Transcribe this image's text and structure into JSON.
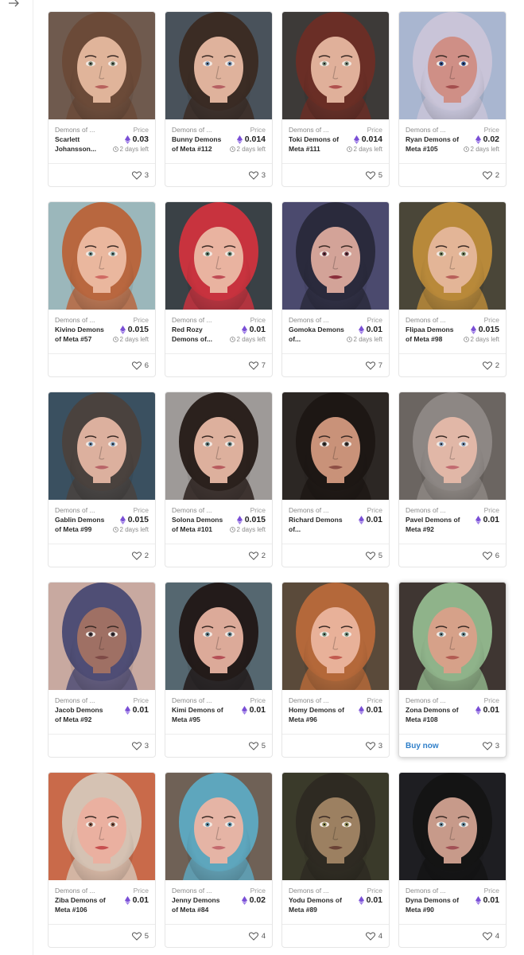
{
  "nav": {
    "back_icon": "arrow-right-icon"
  },
  "colors": {
    "accent": "#2f7fc9",
    "eth": "#7a4fd6",
    "border": "#e6e6e6"
  },
  "cards": [
    {
      "collection": "Demons of ...",
      "name": "Scarlett Johansson...",
      "price_label": "Price",
      "price": "0.03",
      "time": "2 days left",
      "likes": "3",
      "buy": "",
      "hair": "#6b4a38",
      "skin": "#e0b49a",
      "bg": "#6f5a4e",
      "eyes": "#6e7d6a",
      "lips": "#b8625d"
    },
    {
      "collection": "Demons of ...",
      "name": "Bunny Demons of Meta #112",
      "price_label": "Price",
      "price": "0.014",
      "time": "2 days left",
      "likes": "3",
      "buy": "",
      "hair": "#3b2c24",
      "skin": "#dfb29c",
      "bg": "#49525b",
      "eyes": "#6b87a8",
      "lips": "#b66063"
    },
    {
      "collection": "Demons of ...",
      "name": "Toki Demons of Meta #111",
      "price_label": "Price",
      "price": "0.014",
      "time": "2 days left",
      "likes": "5",
      "buy": "",
      "hair": "#6a2e26",
      "skin": "#e0b09a",
      "bg": "#3d3a38",
      "eyes": "#7a8b7a",
      "lips": "#b0514f"
    },
    {
      "collection": "Demons of ...",
      "name": "Ryan Demons of Meta #105",
      "price_label": "Price",
      "price": "0.02",
      "time": "2 days left",
      "likes": "2",
      "buy": "",
      "hair": "#c9c4d8",
      "skin": "#cf8f86",
      "bg": "#a9b6d0",
      "eyes": "#2d4d8a",
      "lips": "#a44e4e"
    },
    {
      "collection": "Demons of ...",
      "name": "Kivino Demons of Meta #57",
      "price_label": "Price",
      "price": "0.015",
      "time": "2 days left",
      "likes": "6",
      "buy": "",
      "hair": "#b8673f",
      "skin": "#eab79e",
      "bg": "#9bb7bb",
      "eyes": "#6f8f8c",
      "lips": "#d06a63"
    },
    {
      "collection": "Demons of ...",
      "name": "Red Rozy Demons of...",
      "price_label": "Price",
      "price": "0.01",
      "time": "2 days left",
      "likes": "7",
      "buy": "",
      "hair": "#c8333e",
      "skin": "#e9b3a0",
      "bg": "#3a4146",
      "eyes": "#5f7f6e",
      "lips": "#c04c55"
    },
    {
      "collection": "Demons of ...",
      "name": "Gomoka Demons of...",
      "price_label": "Price",
      "price": "0.01",
      "time": "2 days left",
      "likes": "7",
      "buy": "",
      "hair": "#2a2a3c",
      "skin": "#d3a398",
      "bg": "#4b4a6e",
      "eyes": "#6b3340",
      "lips": "#8a2e3b"
    },
    {
      "collection": "Demons of ...",
      "name": "Flipaa Demons of Meta #98",
      "price_label": "Price",
      "price": "0.015",
      "time": "2 days left",
      "likes": "2",
      "buy": "",
      "hair": "#b8893a",
      "skin": "#e3b597",
      "bg": "#4a4638",
      "eyes": "#7c8a63",
      "lips": "#b8605a"
    },
    {
      "collection": "Demons of ...",
      "name": "Gablin Demons of Meta #99",
      "price_label": "Price",
      "price": "0.015",
      "time": "2 days left",
      "likes": "2",
      "buy": "",
      "hair": "#4a423e",
      "skin": "#dcb09e",
      "bg": "#3a5060",
      "eyes": "#6f8fae",
      "lips": "#b96468"
    },
    {
      "collection": "Demons of ...",
      "name": "Solona Demons of Meta #101",
      "price_label": "Price",
      "price": "0.015",
      "time": "2 days left",
      "likes": "2",
      "buy": "",
      "hair": "#2b211d",
      "skin": "#ddb09d",
      "bg": "#9e9a98",
      "eyes": "#5f7b7c",
      "lips": "#b85b5e"
    },
    {
      "collection": "Demons of ...",
      "name": "Richard Demons of...",
      "price_label": "Price",
      "price": "0.01",
      "time": "",
      "likes": "5",
      "buy": "",
      "hair": "#1d1714",
      "skin": "#c99279",
      "bg": "#2c2724",
      "eyes": "#3a3330",
      "lips": "#8e4f45"
    },
    {
      "collection": "Demons of ...",
      "name": "Pavel Demons of Meta #92",
      "price_label": "Price",
      "price": "0.01",
      "time": "",
      "likes": "6",
      "buy": "",
      "hair": "#8d8784",
      "skin": "#e1b7a7",
      "bg": "#6b6561",
      "eyes": "#7f98b6",
      "lips": "#c26a70"
    },
    {
      "collection": "Demons of ...",
      "name": "Jacob Demons of Meta #92",
      "price_label": "Price",
      "price": "0.01",
      "time": "",
      "likes": "3",
      "buy": "",
      "hair": "#4f4e75",
      "skin": "#9f7064",
      "bg": "#c8a9a0",
      "eyes": "#3d3238",
      "lips": "#7e4a46"
    },
    {
      "collection": "Demons of ...",
      "name": "Kimi Demons of Meta #95",
      "price_label": "Price",
      "price": "0.01",
      "time": "",
      "likes": "5",
      "buy": "",
      "hair": "#231b1a",
      "skin": "#dcaa99",
      "bg": "#556770",
      "eyes": "#5f7e89",
      "lips": "#b54f56"
    },
    {
      "collection": "Demons of ...",
      "name": "Homy Demons of Meta #96",
      "price_label": "Price",
      "price": "0.01",
      "time": "",
      "likes": "3",
      "buy": "",
      "hair": "#b4683a",
      "skin": "#e8b199",
      "bg": "#5a4a3a",
      "eyes": "#6e8f7c",
      "lips": "#c25a4f"
    },
    {
      "collection": "Demons of ...",
      "name": "Zona Demons of Meta #108",
      "price_label": "Price",
      "price": "0.01",
      "time": "",
      "likes": "3",
      "buy": "Buy now",
      "hair": "#8fb38a",
      "skin": "#d6a189",
      "bg": "#3f3632",
      "eyes": "#6c8c92",
      "lips": "#b25b52"
    },
    {
      "collection": "Demons of ...",
      "name": "Ziba Demons of Meta #106",
      "price_label": "Price",
      "price": "0.01",
      "time": "",
      "likes": "5",
      "buy": "",
      "hair": "#d5c2b3",
      "skin": "#eab0a0",
      "bg": "#c96a4a",
      "eyes": "#8a5a48",
      "lips": "#c74f4f"
    },
    {
      "collection": "Demons of ...",
      "name": "Jenny Demons of Meta #84",
      "price_label": "Price",
      "price": "0.02",
      "time": "",
      "likes": "4",
      "buy": "",
      "hair": "#5ea6bd",
      "skin": "#e5b4a5",
      "bg": "#6f6156",
      "eyes": "#5d8fa8",
      "lips": "#c46a6e"
    },
    {
      "collection": "Demons of ...",
      "name": "Yodu Demons of Meta #89",
      "price_label": "Price",
      "price": "0.01",
      "time": "",
      "likes": "4",
      "buy": "",
      "hair": "#2e2a22",
      "skin": "#9c8061",
      "bg": "#3a3a2a",
      "eyes": "#8c8a52",
      "lips": "#6a4236"
    },
    {
      "collection": "Demons of ...",
      "name": "Dyna Demons of Meta #90",
      "price_label": "Price",
      "price": "0.01",
      "time": "",
      "likes": "4",
      "buy": "",
      "hair": "#141414",
      "skin": "#c79a8a",
      "bg": "#1e1e22",
      "eyes": "#6a8ea0",
      "lips": "#a25055"
    }
  ]
}
